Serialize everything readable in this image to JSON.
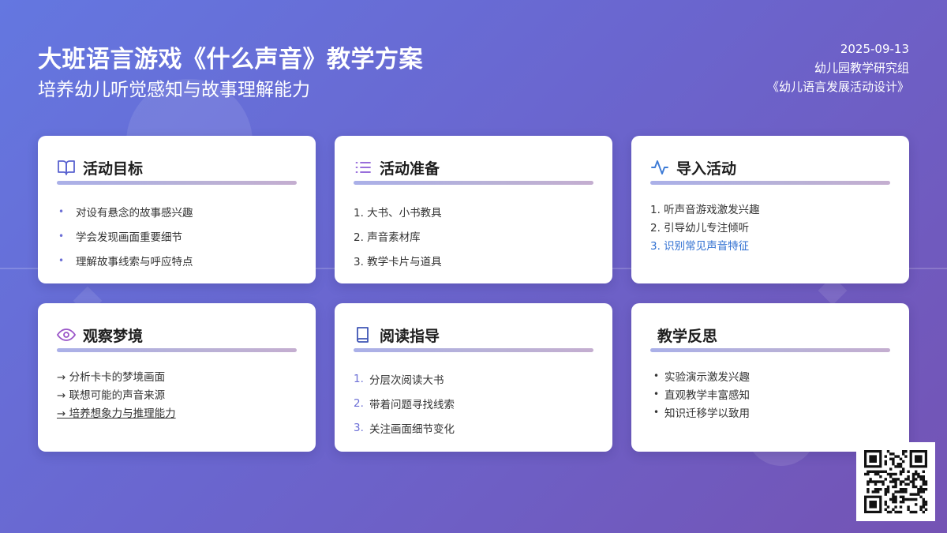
{
  "header": {
    "title": "大班语言游戏《什么声音》教学方案",
    "subtitle": "培养幼儿听觉感知与故事理解能力",
    "date": "2025-09-13",
    "org": "幼儿园教学研究组",
    "book": "《幼儿语言发展活动设计》"
  },
  "cards": [
    {
      "title": "活动目标",
      "icon": "book-open-icon",
      "items": [
        "对设有悬念的故事感兴趣",
        "学会发现画面重要细节",
        "理解故事线索与呼应特点"
      ]
    },
    {
      "title": "活动准备",
      "icon": "list-icon",
      "items": [
        "1. 大书、小书教具",
        "2. 声音素材库",
        "3. 教学卡片与道具"
      ]
    },
    {
      "title": "导入活动",
      "icon": "pulse-icon",
      "items": [
        "1. 听声音游戏激发兴趣",
        "2. 引导幼儿专注倾听",
        "3. 识别常见声音特征"
      ]
    },
    {
      "title": "观察梦境",
      "icon": "eye-icon",
      "items": [
        "→ 分析卡卡的梦境画面",
        "→ 联想可能的声音来源",
        "→ 培养想象力与推理能力"
      ]
    },
    {
      "title": "阅读指导",
      "icon": "book-icon",
      "numbers": [
        "1.",
        "2.",
        "3."
      ],
      "items": [
        "分层次阅读大书",
        "带着问题寻找线索",
        "关注画面细节变化"
      ]
    },
    {
      "title": "教学反思",
      "icon": "",
      "items": [
        "实验演示激发兴趣",
        "直观教学丰富感知",
        "知识迁移学以致用"
      ]
    }
  ],
  "colors": {
    "accent": "#6c6fd6",
    "highlight": "#2f6fd1",
    "bg_start": "#6477e0",
    "bg_end": "#7453b4"
  }
}
